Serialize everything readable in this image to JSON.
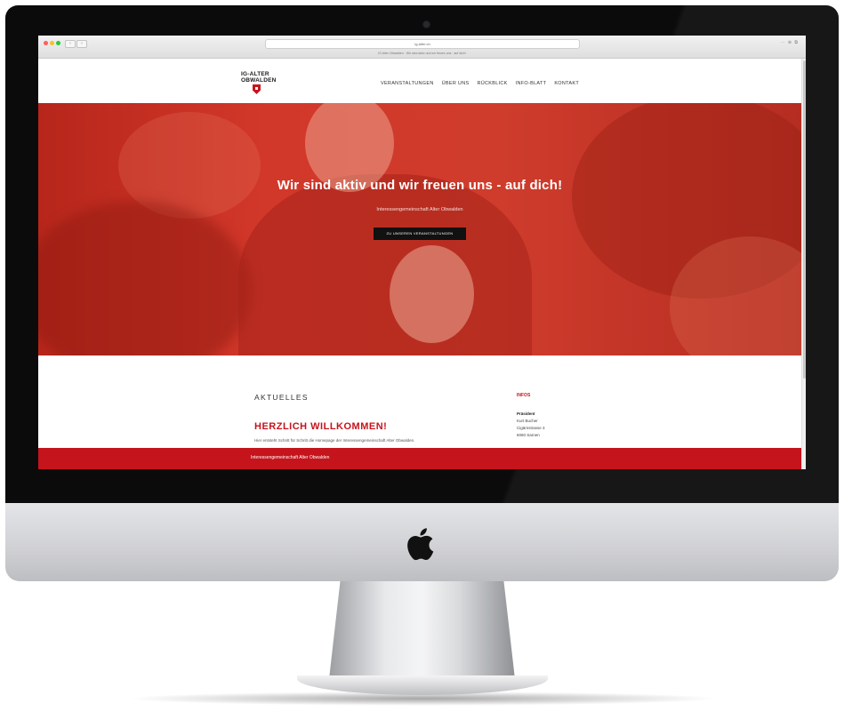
{
  "browser": {
    "address": "ig-alter.ch",
    "notice": "IG Alter Obwalden · Wir sind aktiv und wir freuen uns · auf dich!"
  },
  "site": {
    "logo_line1": "IG-ALTER",
    "logo_line2": "OBWALDEN",
    "nav": [
      "VERANSTALTUNGEN",
      "ÜBER UNS",
      "RÜCKBLICK",
      "INFO-BLATT",
      "KONTAKT"
    ]
  },
  "hero": {
    "title": "Wir sind aktiv und wir freuen uns - auf dich!",
    "subtitle": "Interessengemeinschaft Alter Obwalden",
    "button": "ZU UNSEREN VERANSTALTUNGEN"
  },
  "main": {
    "section_label": "AKTUELLES",
    "heading": "HERZLICH WILLKOMMEN!",
    "intro": "Hier entsteht Schritt für Schritt die Homepage der Interessengemeinschaft Alter Obwalden."
  },
  "sidebar": {
    "heading": "INFOS",
    "role": "Präsident",
    "name": "Kurt Bucher",
    "street": "Cigärnstrasse 3",
    "city": "6060 Sarnen"
  },
  "footer": {
    "text": "Interessengemeinschaft Alter Obwalden"
  },
  "colors": {
    "brand_red": "#c5141c",
    "hero_overlay": "#d2382a",
    "button_dark": "#111111"
  }
}
